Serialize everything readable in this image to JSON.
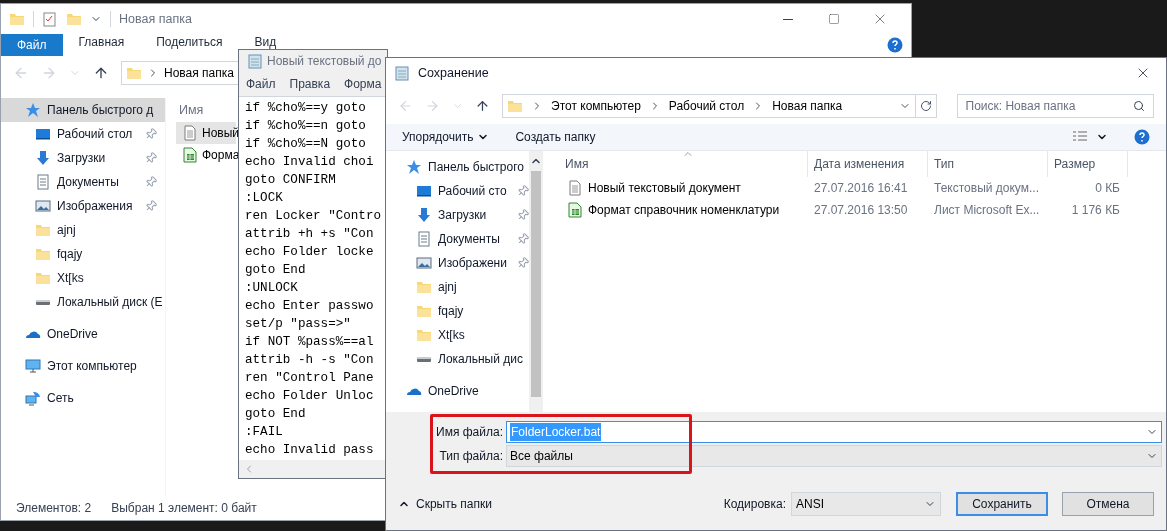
{
  "explorer": {
    "title": "Новая папка",
    "ribbon_tabs": [
      {
        "label": "Файл",
        "selected": true
      },
      {
        "label": "Главная",
        "selected": false
      },
      {
        "label": "Поделиться",
        "selected": false
      },
      {
        "label": "Вид",
        "selected": false
      }
    ],
    "address": "Новая папка",
    "nav": [
      {
        "label": "Панель быстрого д",
        "kind": "quick",
        "selected": true,
        "pinned": false
      },
      {
        "label": "Рабочий стол",
        "kind": "desktop",
        "selected": false,
        "pinned": true
      },
      {
        "label": "Загрузки",
        "kind": "downloads",
        "selected": false,
        "pinned": true
      },
      {
        "label": "Документы",
        "kind": "documents",
        "selected": false,
        "pinned": true
      },
      {
        "label": "Изображения",
        "kind": "pictures",
        "selected": false,
        "pinned": true
      },
      {
        "label": "ajnj",
        "kind": "folder",
        "selected": false,
        "pinned": false
      },
      {
        "label": "fqajy",
        "kind": "folder",
        "selected": false,
        "pinned": false
      },
      {
        "label": "Xt[ks",
        "kind": "folder",
        "selected": false,
        "pinned": false
      },
      {
        "label": "Локальный диск (E",
        "kind": "drive",
        "selected": false,
        "pinned": false
      },
      {
        "label": "OneDrive",
        "kind": "cloud",
        "selected": false,
        "pinned": false
      },
      {
        "label": "Этот компьютер",
        "kind": "pc",
        "selected": false,
        "pinned": false
      },
      {
        "label": "Сеть",
        "kind": "network",
        "selected": false,
        "pinned": false
      }
    ],
    "column_1": "Имя",
    "files": [
      {
        "name": "Новый",
        "kind": "text",
        "selected": true
      },
      {
        "name": "Форма",
        "kind": "sheet",
        "selected": false
      }
    ],
    "status": [
      "Элементов: 2",
      "Выбран 1 элемент: 0 байт"
    ]
  },
  "notepad": {
    "title": "Новый текстовый до",
    "menu": [
      "Файл",
      "Правка",
      "Форма"
    ],
    "lines": [
      "if %cho%==y goto",
      "if %cho%==n goto",
      "if %cho%==N goto",
      "echo Invalid choi",
      "goto CONFIRM",
      ":LOCK",
      "ren Locker \"Contro",
      "attrib +h +s \"Con",
      "echo Folder locke",
      "goto End",
      ":UNLOCK",
      "echo Enter passwo",
      "set/p \"pass=>\"",
      "if NOT %pass%==al",
      "attrib -h -s \"Con",
      "ren \"Control Pane",
      "echo Folder Unloc",
      "goto End",
      ":FAIL",
      "echo Invalid pass"
    ]
  },
  "dialog": {
    "title": "Сохранение",
    "breadcrumb": [
      "Этот компьютер",
      "Рабочий стол",
      "Новая папка"
    ],
    "search": {
      "placeholder": "Поиск: Новая папка"
    },
    "toolbar": {
      "organize": "Упорядочить",
      "new_folder": "Создать папку"
    },
    "nav": [
      {
        "label": "Панель быстрого",
        "kind": "quick",
        "pinned": false
      },
      {
        "label": "Рабочий сто",
        "kind": "desktop",
        "pinned": true
      },
      {
        "label": "Загрузки",
        "kind": "downloads",
        "pinned": true
      },
      {
        "label": "Документы",
        "kind": "documents",
        "pinned": true
      },
      {
        "label": "Изображени",
        "kind": "pictures",
        "pinned": true
      },
      {
        "label": "ajnj",
        "kind": "folder",
        "pinned": false
      },
      {
        "label": "fqajy",
        "kind": "folder",
        "pinned": false
      },
      {
        "label": "Xt[ks",
        "kind": "folder",
        "pinned": false
      },
      {
        "label": "Локальный дис",
        "kind": "drive",
        "pinned": false
      },
      {
        "label": "OneDrive",
        "kind": "cloud",
        "pinned": false
      }
    ],
    "columns": [
      "Имя",
      "Дата изменения",
      "Тип",
      "Размер"
    ],
    "files": [
      {
        "name": "Новый текстовый документ",
        "kind": "text",
        "date": "27.07.2016 16:41",
        "type": "Текстовый докум...",
        "size": "0 КБ"
      },
      {
        "name": "Формат справочник номенклатури",
        "kind": "sheet",
        "date": "27.07.2016 13:50",
        "type": "Лист Microsoft Ex...",
        "size": "1 176 КБ"
      }
    ],
    "filename": {
      "label": "Имя файла:",
      "value": "FolderLocker.bat"
    },
    "filetype": {
      "label": "Тип файла:",
      "value": "Все файлы"
    },
    "hide_folders": "Скрыть папки",
    "encoding": {
      "label": "Кодировка:",
      "value": "ANSI"
    },
    "buttons": [
      "Сохранить",
      "Отмена"
    ]
  }
}
